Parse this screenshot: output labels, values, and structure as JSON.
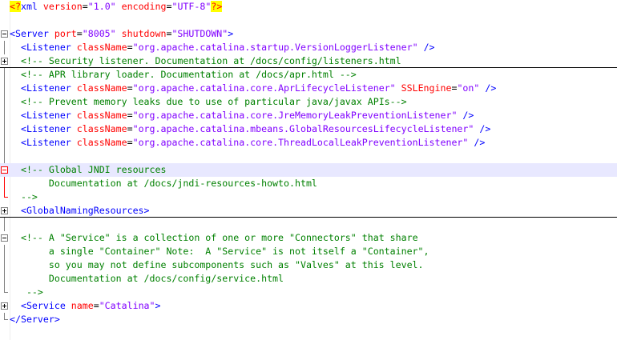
{
  "editor": {
    "colors": {
      "tag": "#0000ff",
      "attribute": "#ff0000",
      "value": "#8000ff",
      "comment": "#008000",
      "current_line": "#e8e8ff",
      "pi_highlight": "#ffff00"
    },
    "lines": [
      {
        "fold": null,
        "guide": null,
        "tokens": [
          {
            "t": "pi-bracket",
            "v": "<?"
          },
          {
            "t": "tag",
            "v": "xml "
          },
          {
            "t": "attr",
            "v": "version"
          },
          {
            "t": "plain",
            "v": "="
          },
          {
            "t": "value",
            "v": "\"1.0\""
          },
          {
            "t": "plain",
            "v": " "
          },
          {
            "t": "attr",
            "v": "encoding"
          },
          {
            "t": "plain",
            "v": "="
          },
          {
            "t": "value",
            "v": "\"UTF-8\""
          },
          {
            "t": "pi-bracket",
            "v": "?>"
          }
        ]
      },
      {
        "fold": null,
        "guide": null,
        "tokens": []
      },
      {
        "fold": "minus",
        "guide": null,
        "tokens": [
          {
            "t": "tag",
            "v": "<Server "
          },
          {
            "t": "attr",
            "v": "port"
          },
          {
            "t": "plain",
            "v": "="
          },
          {
            "t": "value",
            "v": "\"8005\""
          },
          {
            "t": "plain",
            "v": " "
          },
          {
            "t": "attr",
            "v": "shutdown"
          },
          {
            "t": "plain",
            "v": "="
          },
          {
            "t": "value",
            "v": "\"SHUTDOWN\""
          },
          {
            "t": "tag",
            "v": ">"
          }
        ]
      },
      {
        "fold": null,
        "guide": "line",
        "tokens": [
          {
            "t": "plain",
            "v": "  "
          },
          {
            "t": "tag",
            "v": "<Listener "
          },
          {
            "t": "attr",
            "v": "className"
          },
          {
            "t": "plain",
            "v": "="
          },
          {
            "t": "value",
            "v": "\"org.apache.catalina.startup.VersionLoggerListener\""
          },
          {
            "t": "plain",
            "v": " "
          },
          {
            "t": "tag",
            "v": "/>"
          }
        ]
      },
      {
        "fold": "plus",
        "guide": null,
        "sep": true,
        "tokens": [
          {
            "t": "plain",
            "v": "  "
          },
          {
            "t": "comment",
            "v": "<!-- Security listener. Documentation at /docs/config/listeners.html"
          }
        ]
      },
      {
        "fold": null,
        "guide": "line",
        "tokens": [
          {
            "t": "plain",
            "v": "  "
          },
          {
            "t": "comment",
            "v": "<!-- APR library loader. Documentation at /docs/apr.html -->"
          }
        ]
      },
      {
        "fold": null,
        "guide": "line",
        "tokens": [
          {
            "t": "plain",
            "v": "  "
          },
          {
            "t": "tag",
            "v": "<Listener "
          },
          {
            "t": "attr",
            "v": "className"
          },
          {
            "t": "plain",
            "v": "="
          },
          {
            "t": "value",
            "v": "\"org.apache.catalina.core.AprLifecycleListener\""
          },
          {
            "t": "plain",
            "v": " "
          },
          {
            "t": "attr",
            "v": "SSLEngine"
          },
          {
            "t": "plain",
            "v": "="
          },
          {
            "t": "value",
            "v": "\"on\""
          },
          {
            "t": "plain",
            "v": " "
          },
          {
            "t": "tag",
            "v": "/>"
          }
        ]
      },
      {
        "fold": null,
        "guide": "line",
        "tokens": [
          {
            "t": "plain",
            "v": "  "
          },
          {
            "t": "comment",
            "v": "<!-- Prevent memory leaks due to use of particular java/javax APIs-->"
          }
        ]
      },
      {
        "fold": null,
        "guide": "line",
        "tokens": [
          {
            "t": "plain",
            "v": "  "
          },
          {
            "t": "tag",
            "v": "<Listener "
          },
          {
            "t": "attr",
            "v": "className"
          },
          {
            "t": "plain",
            "v": "="
          },
          {
            "t": "value",
            "v": "\"org.apache.catalina.core.JreMemoryLeakPreventionListener\""
          },
          {
            "t": "plain",
            "v": " "
          },
          {
            "t": "tag",
            "v": "/>"
          }
        ]
      },
      {
        "fold": null,
        "guide": "line",
        "tokens": [
          {
            "t": "plain",
            "v": "  "
          },
          {
            "t": "tag",
            "v": "<Listener "
          },
          {
            "t": "attr",
            "v": "className"
          },
          {
            "t": "plain",
            "v": "="
          },
          {
            "t": "value",
            "v": "\"org.apache.catalina.mbeans.GlobalResourcesLifecycleListener\""
          },
          {
            "t": "plain",
            "v": " "
          },
          {
            "t": "tag",
            "v": "/>"
          }
        ]
      },
      {
        "fold": null,
        "guide": "line",
        "tokens": [
          {
            "t": "plain",
            "v": "  "
          },
          {
            "t": "tag",
            "v": "<Listener "
          },
          {
            "t": "attr",
            "v": "className"
          },
          {
            "t": "plain",
            "v": "="
          },
          {
            "t": "value",
            "v": "\"org.apache.catalina.core.ThreadLocalLeakPreventionListener\""
          },
          {
            "t": "plain",
            "v": " "
          },
          {
            "t": "tag",
            "v": "/>"
          }
        ]
      },
      {
        "fold": null,
        "guide": "line",
        "tokens": []
      },
      {
        "fold": "minus-red",
        "guide": null,
        "current": true,
        "tokens": [
          {
            "t": "plain",
            "v": "  "
          },
          {
            "t": "comment",
            "v": "<!-- Global JNDI resources"
          }
        ]
      },
      {
        "fold": null,
        "guide": "red",
        "tokens": [
          {
            "t": "comment",
            "v": "       Documentation at /docs/jndi-resources-howto.html"
          }
        ]
      },
      {
        "fold": null,
        "guide": "red-end",
        "tokens": [
          {
            "t": "comment",
            "v": "  -->"
          }
        ]
      },
      {
        "fold": "plus",
        "guide": null,
        "sep": true,
        "tokens": [
          {
            "t": "plain",
            "v": "  "
          },
          {
            "t": "tag",
            "v": "<GlobalNamingResources>"
          }
        ]
      },
      {
        "fold": null,
        "guide": "line",
        "tokens": []
      },
      {
        "fold": "minus",
        "guide": null,
        "tokens": [
          {
            "t": "plain",
            "v": "  "
          },
          {
            "t": "comment",
            "v": "<!-- A \"Service\" is a collection of one or more \"Connectors\" that share"
          }
        ]
      },
      {
        "fold": null,
        "guide": "line",
        "tokens": [
          {
            "t": "comment",
            "v": "       a single \"Container\" Note:  A \"Service\" is not itself a \"Container\","
          }
        ]
      },
      {
        "fold": null,
        "guide": "line",
        "tokens": [
          {
            "t": "comment",
            "v": "       so you may not define subcomponents such as \"Valves\" at this level."
          }
        ]
      },
      {
        "fold": null,
        "guide": "line",
        "tokens": [
          {
            "t": "comment",
            "v": "       Documentation at /docs/config/service.html"
          }
        ]
      },
      {
        "fold": null,
        "guide": "end",
        "tokens": [
          {
            "t": "comment",
            "v": "   -->"
          }
        ]
      },
      {
        "fold": "plus",
        "guide": null,
        "tokens": [
          {
            "t": "plain",
            "v": "  "
          },
          {
            "t": "tag",
            "v": "<Service "
          },
          {
            "t": "attr",
            "v": "name"
          },
          {
            "t": "plain",
            "v": "="
          },
          {
            "t": "value",
            "v": "\"Catalina\""
          },
          {
            "t": "tag",
            "v": ">"
          }
        ]
      },
      {
        "fold": null,
        "guide": "end",
        "tokens": [
          {
            "t": "tag",
            "v": "</Server>"
          }
        ]
      }
    ]
  }
}
